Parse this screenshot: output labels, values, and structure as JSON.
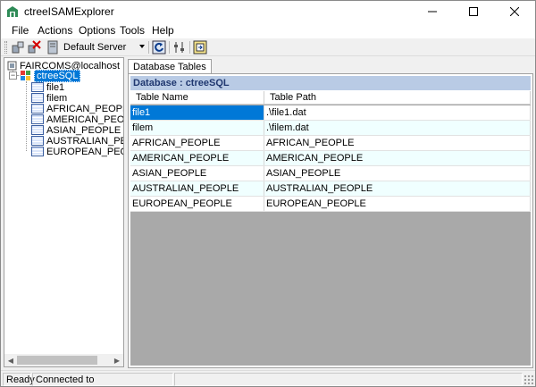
{
  "window": {
    "title": "ctreeISAMExplorer"
  },
  "menu": {
    "items": [
      "File",
      "Actions",
      "Options",
      "Tools",
      "Help"
    ]
  },
  "toolbar": {
    "server": "Default Server"
  },
  "tree": {
    "root": "FAIRCOMS@localhost",
    "database": "ctreeSQL",
    "tables": [
      "file1",
      "filem",
      "AFRICAN_PEOPLE",
      "AMERICAN_PEOPLE",
      "ASIAN_PEOPLE",
      "AUSTRALIAN_PEOPLE",
      "EUROPEAN_PEOPLE"
    ]
  },
  "tab": {
    "label": "Database Tables"
  },
  "panel": {
    "header": "Database : ctreeSQL"
  },
  "grid": {
    "columns": [
      "Table Name",
      "Table Path"
    ],
    "rows": [
      [
        "file1",
        ".\\file1.dat"
      ],
      [
        "filem",
        ".\\filem.dat"
      ],
      [
        "AFRICAN_PEOPLE",
        "AFRICAN_PEOPLE"
      ],
      [
        "AMERICAN_PEOPLE",
        "AMERICAN_PEOPLE"
      ],
      [
        "ASIAN_PEOPLE",
        "ASIAN_PEOPLE"
      ],
      [
        "AUSTRALIAN_PEOPLE",
        "AUSTRALIAN_PEOPLE"
      ],
      [
        "EUROPEAN_PEOPLE",
        "EUROPEAN_PEOPLE"
      ]
    ],
    "selected_row": 0
  },
  "status": {
    "state": "Ready",
    "connection": "Connected to FAIRCOMS@localhost"
  },
  "colors": {
    "selection": "#0078d7",
    "alt_row": "#f0ffff",
    "header_band": "#b9cbe5",
    "empty_area": "#a9a9a9"
  }
}
